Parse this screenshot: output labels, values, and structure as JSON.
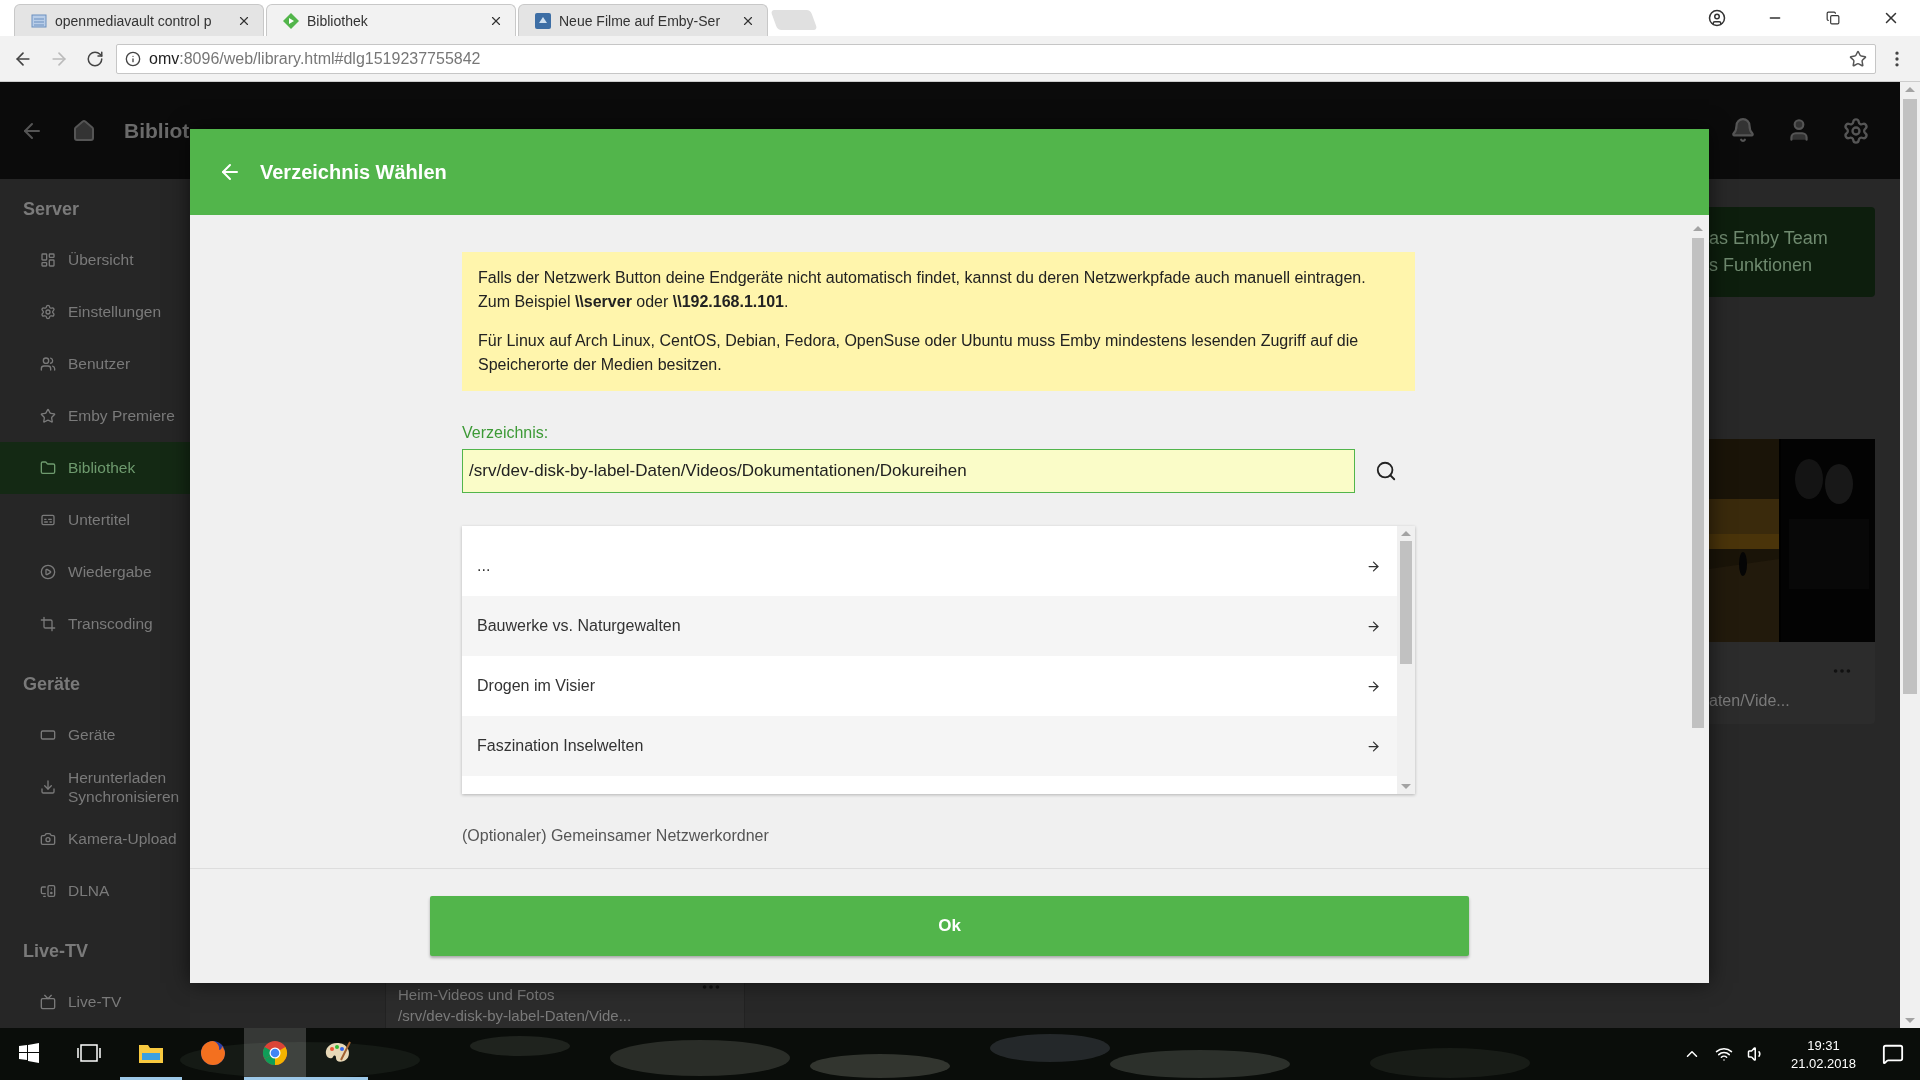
{
  "browser": {
    "tabs": [
      {
        "title": "openmediavault control p",
        "selected": false
      },
      {
        "title": "Bibliothek",
        "selected": true
      },
      {
        "title": "Neue Filme auf Emby-Ser",
        "selected": false
      }
    ],
    "address": {
      "host": "omv",
      "path": ":8096/web/library.html#dlg1519237755842"
    }
  },
  "app_header": {
    "title": "Bibliot"
  },
  "sidebar": {
    "sections": [
      {
        "heading": "Server",
        "items": [
          {
            "label": "Übersicht",
            "selected": false
          },
          {
            "label": "Einstellungen",
            "selected": false
          },
          {
            "label": "Benutzer",
            "selected": false
          },
          {
            "label": "Emby Premiere",
            "selected": false
          },
          {
            "label": "Bibliothek",
            "selected": true
          },
          {
            "label": "Untertitel",
            "selected": false
          },
          {
            "label": "Wiedergabe",
            "selected": false
          },
          {
            "label": "Transcoding",
            "selected": false
          }
        ]
      },
      {
        "heading": "Geräte",
        "items": [
          {
            "label": "Geräte",
            "selected": false
          },
          {
            "label": "Herunterladen\nSynchronisieren",
            "selected": false
          },
          {
            "label": "Kamera-Upload",
            "selected": false
          },
          {
            "label": "DLNA",
            "selected": false
          }
        ]
      },
      {
        "heading": "Live-TV",
        "items": [
          {
            "label": "Live-TV",
            "selected": false
          }
        ]
      }
    ]
  },
  "background": {
    "promo_lines": [
      "as Emby Team",
      "s Funktionen"
    ],
    "poster_card_caption": "aten/Vide...",
    "library_card": {
      "title": "Heim-Videos und Fotos",
      "path": "/srv/dev-disk-by-label-Daten/Vide..."
    }
  },
  "dialog": {
    "title": "Verzeichnis Wählen",
    "info": [
      "Falls der Netzwerk Button deine Endgeräte nicht automatisch findet, kannst du deren Netzwerkpfade auch manuell eintragen. Zum Beispiel **\\\\server** oder **\\\\192.168.1.101**.",
      "Für Linux auf Arch Linux, CentOS, Debian, Fedora, OpenSuse oder Ubuntu muss Emby mindestens lesenden Zugriff auf die Speicherorte der Medien besitzen."
    ],
    "path_label": "Verzeichnis:",
    "path_value": "/srv/dev-disk-by-label-Daten/Videos/Dokumentationen/Dokureihen",
    "folders": [
      "...",
      "Bauwerke vs. Naturgewalten",
      "Drogen im Visier",
      "Faszination Inselwelten"
    ],
    "share_label": "(Optionaler) Gemeinsamer Netzwerkordner",
    "ok_button": "Ok"
  },
  "taskbar": {
    "apps": [
      {
        "running": true,
        "selected": false
      },
      {
        "running": false,
        "selected": false
      },
      {
        "running": true,
        "selected": true
      },
      {
        "running": true,
        "selected": false
      }
    ],
    "time": "19:31",
    "date": "21.02.2018"
  }
}
